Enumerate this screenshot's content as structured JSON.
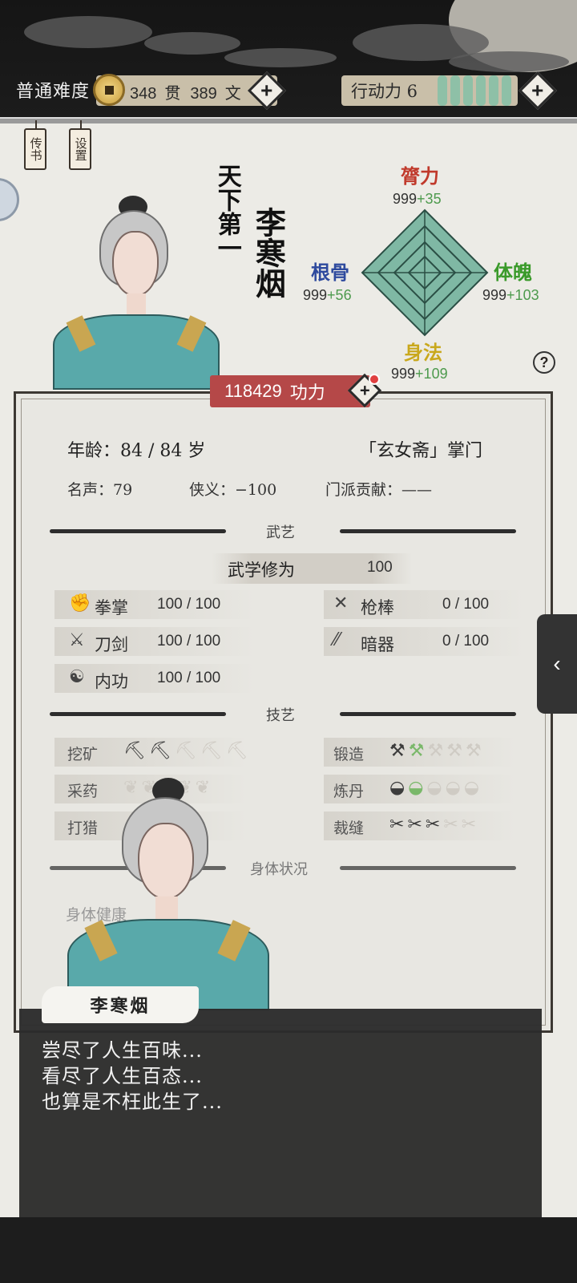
{
  "top_bar": {
    "difficulty": "普通难度",
    "money_guan": "348",
    "guan_unit": "贯",
    "money_wen": "389",
    "wen_unit": "文",
    "action_label": "行动力 6"
  },
  "side_tabs": {
    "biography": "传书",
    "settings": "设置"
  },
  "character": {
    "title": "天下第一",
    "name": "李寒烟"
  },
  "stats": {
    "strength": {
      "label": "膂力",
      "value": "999",
      "bonus": "+35",
      "color": "#c0392b"
    },
    "bone": {
      "label": "根骨",
      "value": "999",
      "bonus": "+56",
      "color": "#2e4a9e"
    },
    "physique": {
      "label": "体魄",
      "value": "999",
      "bonus": "+103",
      "color": "#3a9a2a"
    },
    "agility": {
      "label": "身法",
      "value": "999",
      "bonus": "+109",
      "color": "#c9a81c"
    }
  },
  "power": {
    "value": "118429",
    "unit": "功力"
  },
  "info": {
    "age": "年龄：84 / 84 岁",
    "sect": "「玄女斋」掌门",
    "fame": "名声：79",
    "chivalry": "侠义：−100",
    "contribution": "门派贡献：——"
  },
  "martial": {
    "section": "武艺",
    "cultivation_label": "武学修为",
    "cultivation_value": "100",
    "skills": [
      {
        "name": "拳掌",
        "value": "100 / 100"
      },
      {
        "name": "刀剑",
        "value": "100 / 100"
      },
      {
        "name": "内功",
        "value": "100 / 100"
      },
      {
        "name": "枪棒",
        "value": "0 / 100"
      },
      {
        "name": "暗器",
        "value": "0 / 100"
      }
    ]
  },
  "crafts": {
    "section": "技艺",
    "items": [
      {
        "name": "挖矿",
        "level": 2,
        "max": 5
      },
      {
        "name": "采药",
        "level": 0,
        "max": 5
      },
      {
        "name": "打猎",
        "level": 0,
        "max": 5
      },
      {
        "name": "锻造",
        "level": 2,
        "max": 5
      },
      {
        "name": "炼丹",
        "level": 2,
        "max": 5
      },
      {
        "name": "裁缝",
        "level": 3,
        "max": 5
      }
    ]
  },
  "body": {
    "section": "身体状况",
    "status": "身体健康"
  },
  "dialogue": {
    "speaker": "李寒烟",
    "lines": [
      "尝尽了人生百味...",
      "看尽了人生百态...",
      "也算是不枉此生了..."
    ]
  },
  "icons": {
    "coin": "coin-icon",
    "plus": "plus-icon",
    "help": "help-icon",
    "collapse": "chevron-left-icon"
  }
}
